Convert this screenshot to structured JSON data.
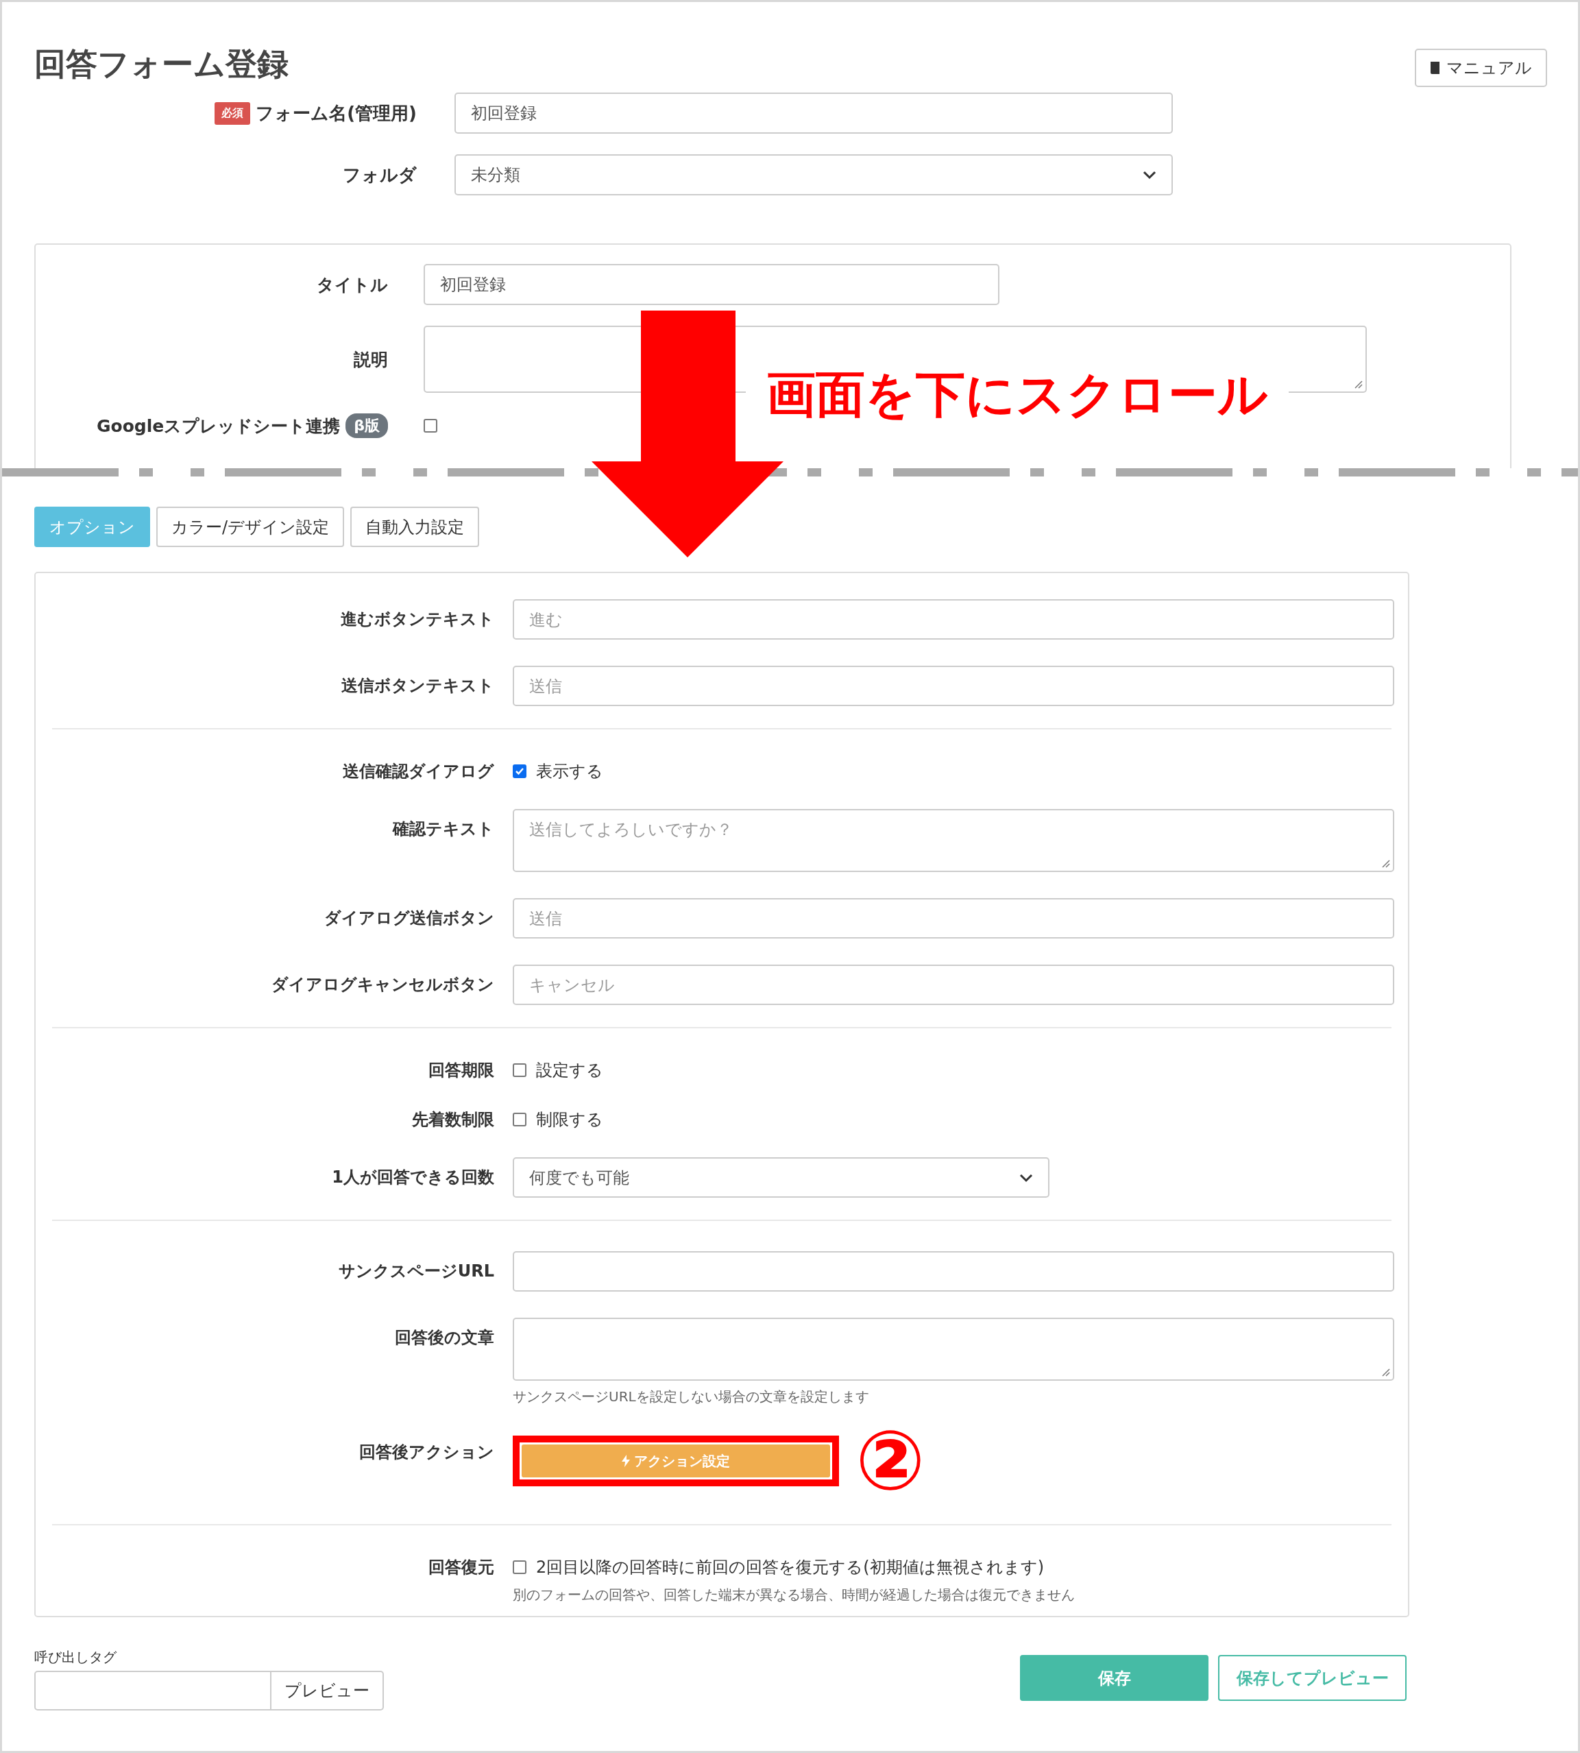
{
  "page": {
    "title": "回答フォーム登録",
    "manual_button": "マニュアル"
  },
  "form_fields": [
    {
      "label": "フォーム名(管理用)",
      "required_badge": "必須",
      "kind": "text",
      "value": "初回登録"
    },
    {
      "label": "フォルダ",
      "kind": "select",
      "value": "未分類"
    }
  ],
  "basic_panel": {
    "rows": [
      {
        "label": "タイトル",
        "kind": "text",
        "value": "初回登録"
      },
      {
        "label": "説明",
        "kind": "textarea"
      },
      {
        "label": "Googleスプレッドシート連携",
        "badge": "β版",
        "kind": "checkbox",
        "checked": false
      }
    ]
  },
  "tabs": [
    {
      "label": "オプション",
      "selected": true
    },
    {
      "label": "カラー/デザイン設定",
      "selected": false
    },
    {
      "label": "自動入力設定",
      "selected": false
    }
  ],
  "option_sections": [
    {
      "rows": [
        {
          "label": "進むボタンテキスト",
          "kind": "text",
          "placeholder": "進む"
        },
        {
          "label": "送信ボタンテキスト",
          "kind": "text",
          "placeholder": "送信"
        }
      ]
    },
    {
      "rows": [
        {
          "label": "送信確認ダイアログ",
          "kind": "checkbox",
          "option": "表示する",
          "checked": true
        },
        {
          "label": "確認テキスト",
          "kind": "textarea",
          "placeholder": "送信してよろしいですか？"
        },
        {
          "label": "ダイアログ送信ボタン",
          "kind": "text",
          "placeholder": "送信"
        },
        {
          "label": "ダイアログキャンセルボタン",
          "kind": "text",
          "placeholder": "キャンセル"
        }
      ]
    },
    {
      "rows": [
        {
          "label": "回答期限",
          "kind": "checkbox",
          "option": "設定する",
          "checked": false
        },
        {
          "label": "先着数制限",
          "kind": "checkbox",
          "option": "制限する",
          "checked": false
        },
        {
          "label": "1人が回答できる回数",
          "kind": "select",
          "value": "何度でも可能"
        }
      ]
    },
    {
      "rows": [
        {
          "label": "サンクスページURL",
          "kind": "text"
        },
        {
          "label": "回答後の文章",
          "kind": "textarea",
          "hint": "サンクスページURLを設定しない場合の文章を設定します"
        },
        {
          "label": "回答後アクション",
          "kind": "button",
          "button": "アクション設定",
          "highlighted": true,
          "step": "②"
        }
      ]
    },
    {
      "rows": [
        {
          "label": "回答復元",
          "kind": "checkbox",
          "option": "2回目以降の回答時に前回の回答を復元する(初期値は無視されます)",
          "checked": false,
          "hint": "別のフォームの回答や、回答した端末が異なる場合、時間が経過した場合は復元できません"
        }
      ]
    }
  ],
  "call_tag": {
    "label": "呼び出しタグ",
    "button": "プレビュー"
  },
  "actions": [
    {
      "label": "保存",
      "kind": "primary"
    },
    {
      "label": "保存してプレビュー",
      "kind": "outline"
    }
  ],
  "annotations": {
    "scroll_text": "画面を下にスクロール"
  }
}
